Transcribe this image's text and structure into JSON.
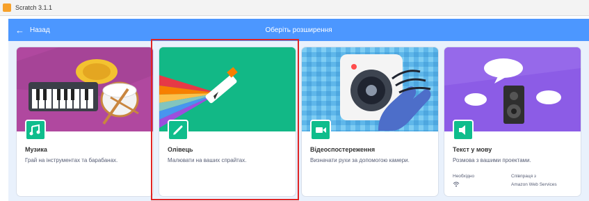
{
  "window": {
    "title": "Scratch 3.1.1"
  },
  "header": {
    "back_label": "Назад",
    "title": "Оберіть розширення"
  },
  "extensions": [
    {
      "title": "Музика",
      "description": "Грай на інструментах та барабанах.",
      "icon": "music-note-icon",
      "color": "#0fbd8c"
    },
    {
      "title": "Олівець",
      "description": "Малювати на ваших спрайтах.",
      "icon": "pen-icon",
      "color": "#0fbd8c",
      "selected": true
    },
    {
      "title": "Відеоспостереження",
      "description": "Визначати рухи за допомогою камери.",
      "icon": "video-camera-icon",
      "color": "#0fbd8c"
    },
    {
      "title": "Текст у мову",
      "description": "Розмова з вашими проектами.",
      "icon": "speaker-icon",
      "color": "#0fbd8c",
      "requires_label": "Необхідно",
      "collab_label": "Співпраця з",
      "collab_name": "Amazon Web Services",
      "requirement_icon": "wifi-icon"
    }
  ],
  "colors": {
    "header": "#4c97ff",
    "background": "#e9f1fc",
    "selection": "#e02424"
  }
}
